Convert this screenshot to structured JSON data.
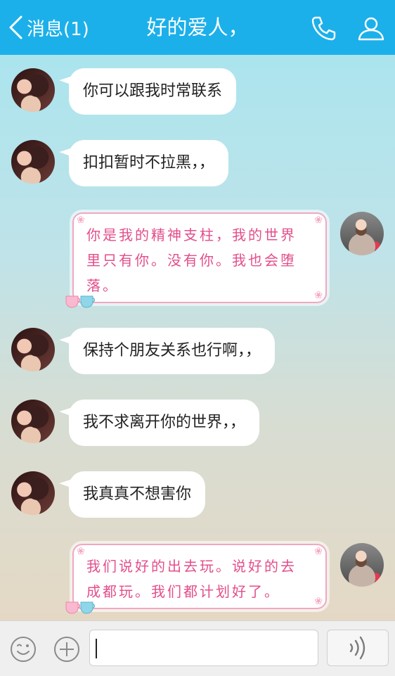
{
  "header": {
    "back_label": "消息(1)",
    "title": "好的爱人，",
    "bg_color": "#1cb0ea",
    "icons": [
      "chevron-left-icon",
      "phone-icon",
      "profile-icon"
    ]
  },
  "messages": [
    {
      "side": "left",
      "style": "plain",
      "text": "你可以跟我时常联系"
    },
    {
      "side": "left",
      "style": "plain",
      "text": "扣扣暂时不拉黑，，"
    },
    {
      "side": "right",
      "style": "cute",
      "lines": [
        "你是我的精神支柱，我的世界",
        "里只有你。没有你。我也会堕",
        "落。"
      ]
    },
    {
      "side": "left",
      "style": "plain",
      "text": "保持个朋友关系也行啊，，"
    },
    {
      "side": "left",
      "style": "plain",
      "text": "我不求离开你的世界，，"
    },
    {
      "side": "left",
      "style": "plain",
      "text": "我真真不想害你"
    },
    {
      "side": "right",
      "style": "cute",
      "lines": [
        "我们说好的出去玩。说好的去",
        "成都玩。我们都计划好了。"
      ]
    }
  ],
  "bottom_bar": {
    "input_value": "",
    "icons": [
      "emoji-icon",
      "plus-icon",
      "voice-icon"
    ]
  }
}
